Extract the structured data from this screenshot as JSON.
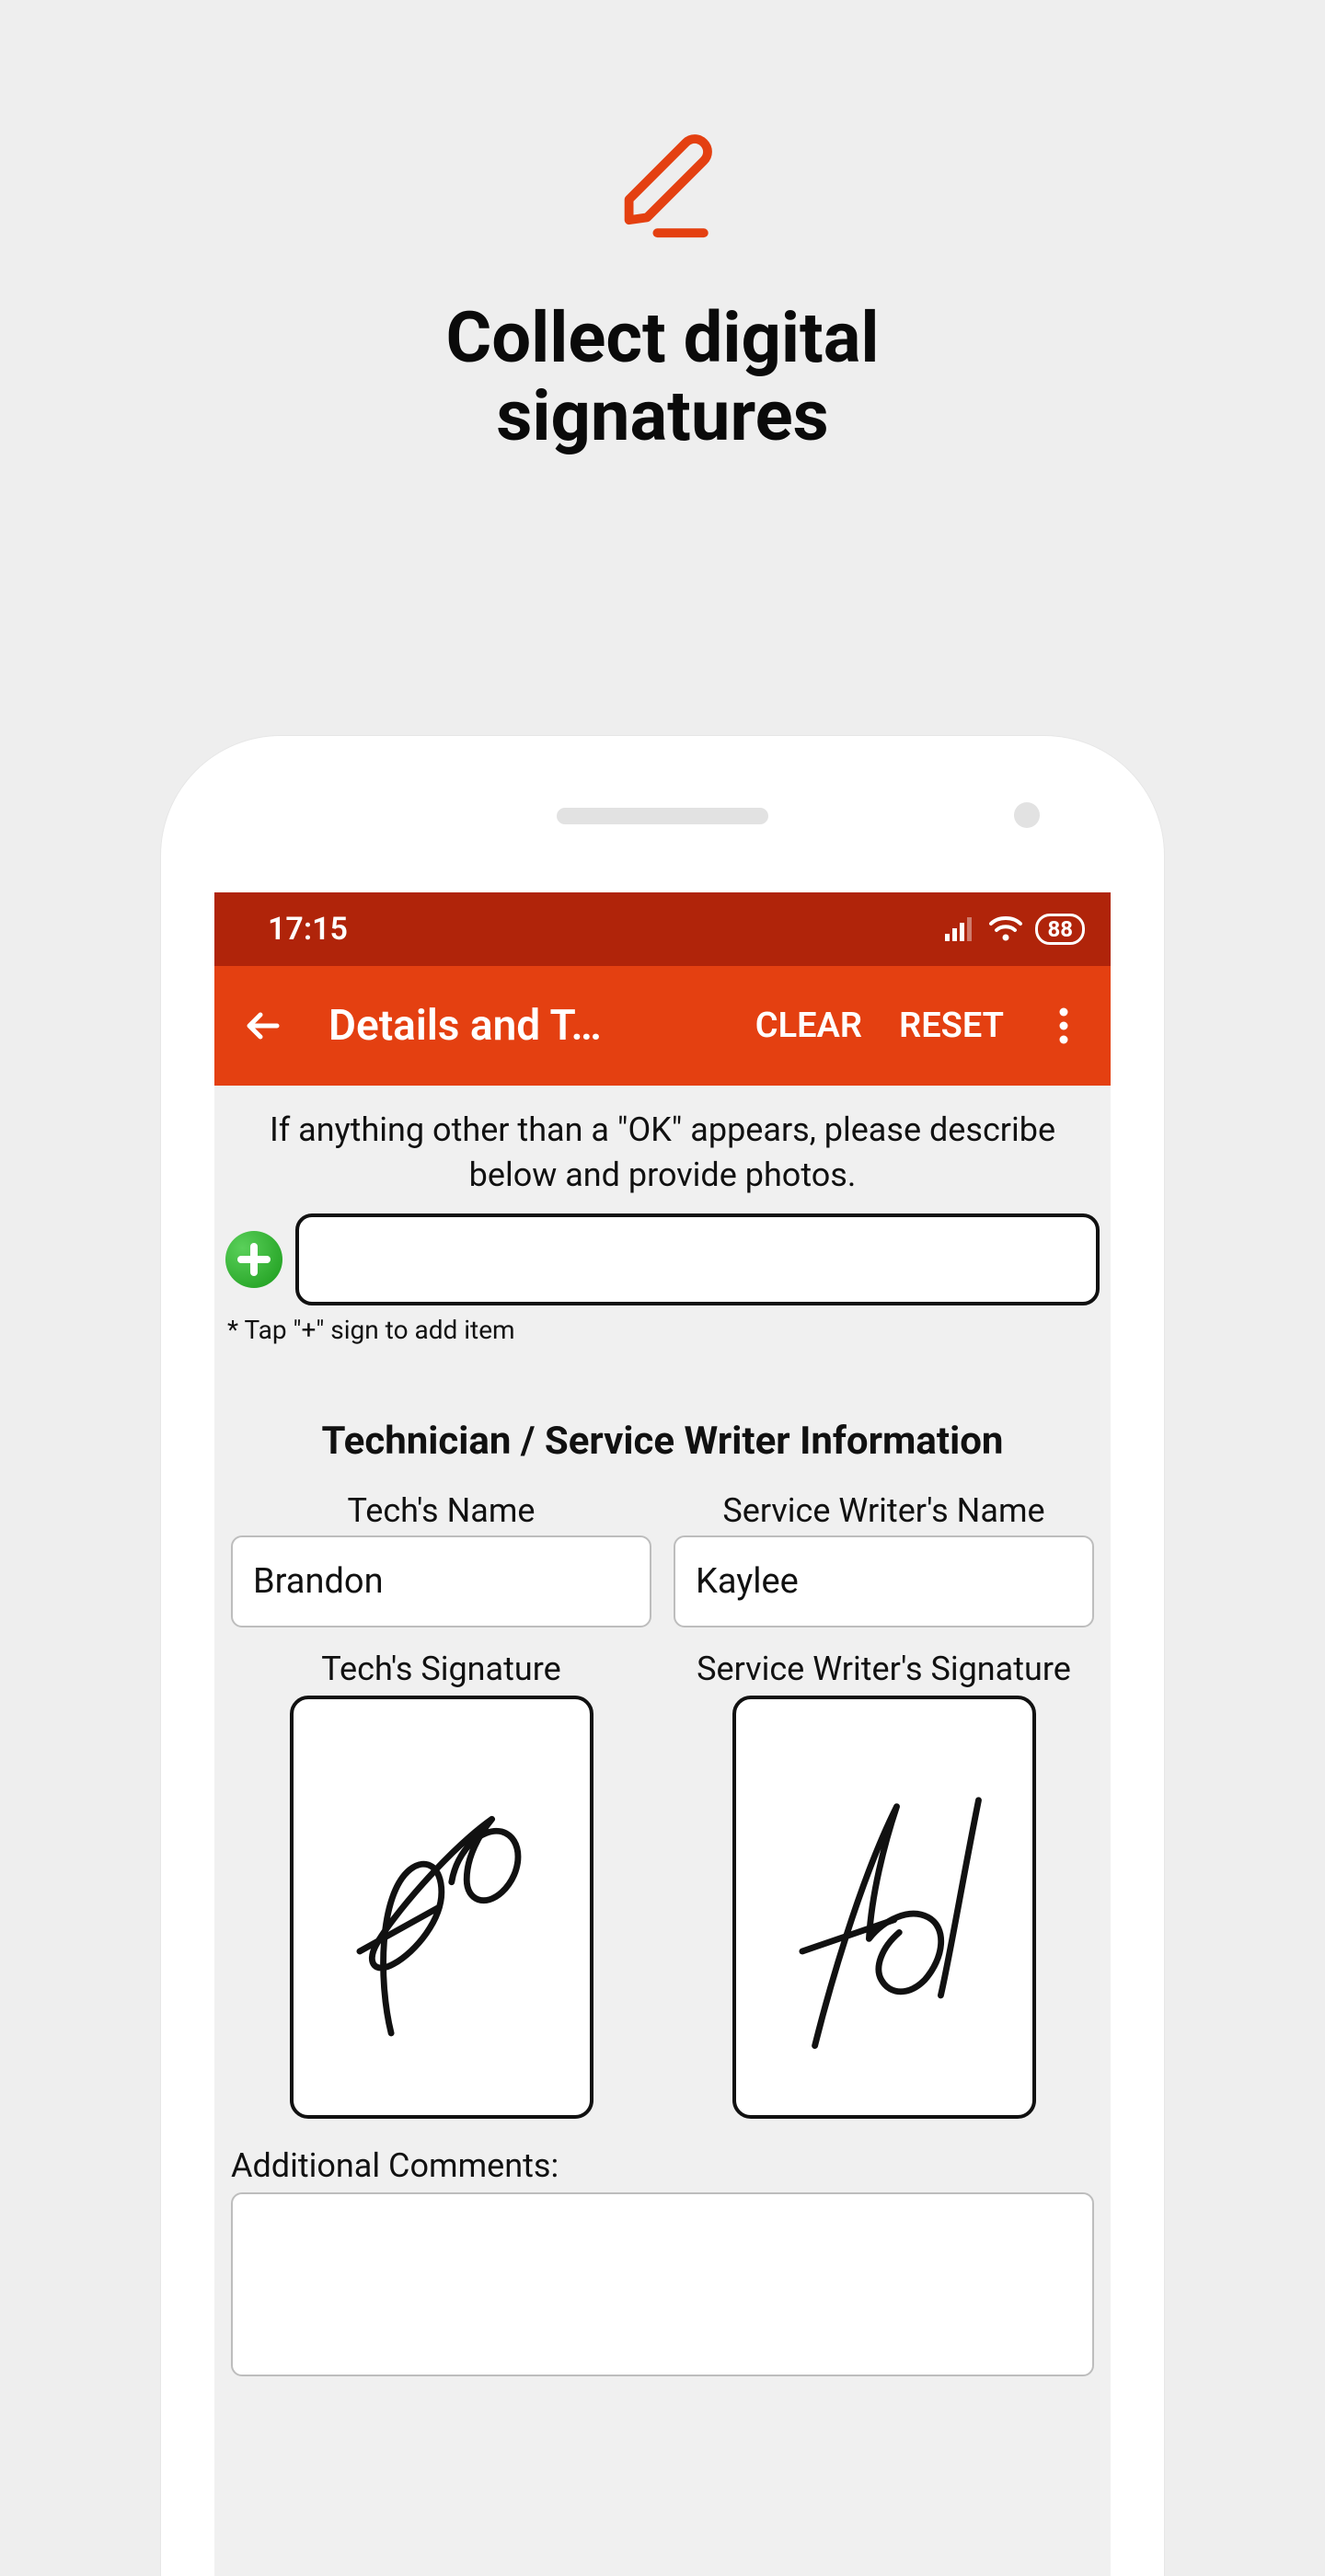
{
  "hero": {
    "title_line1": "Collect digital",
    "title_line2": "signatures"
  },
  "status": {
    "time": "17:15",
    "battery": "88"
  },
  "appbar": {
    "title": "Details and T…",
    "clear": "CLEAR",
    "reset": "RESET"
  },
  "form": {
    "instruction": "If anything other than a \"OK\" appears, please describe below and provide photos.",
    "add_hint": "* Tap \"+\" sign to add item",
    "section_title": "Technician / Service Writer Information",
    "tech_name_label": "Tech's Name",
    "tech_name_value": "Brandon",
    "writer_name_label": "Service Writer's Name",
    "writer_name_value": "Kaylee",
    "tech_sig_label": "Tech's Signature",
    "writer_sig_label": "Service Writer's Signature",
    "comments_label": "Additional Comments:"
  }
}
